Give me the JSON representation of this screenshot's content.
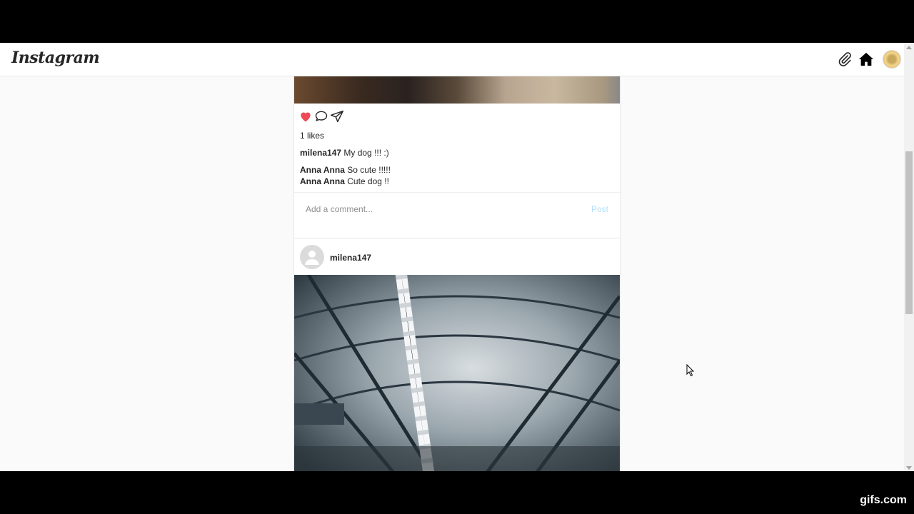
{
  "navbar": {
    "logo": "Instagram",
    "icons": [
      "paperclip-icon",
      "home-icon",
      "avatar"
    ]
  },
  "posts": [
    {
      "likes": "1 likes",
      "caption": {
        "user": "milena147",
        "text": " My dog !!! :)"
      },
      "comments": [
        {
          "user": "Anna Anna",
          "text": " So cute !!!!!"
        },
        {
          "user": "Anna Anna",
          "text": " Cute dog !!"
        }
      ],
      "comment_placeholder": "Add a comment...",
      "post_label": "Post"
    },
    {
      "user": "milena147"
    }
  ],
  "watermark": "gifs.com",
  "colors": {
    "like": "#ed4956",
    "post_button": "#b2dffc",
    "background": "#fafafa"
  }
}
